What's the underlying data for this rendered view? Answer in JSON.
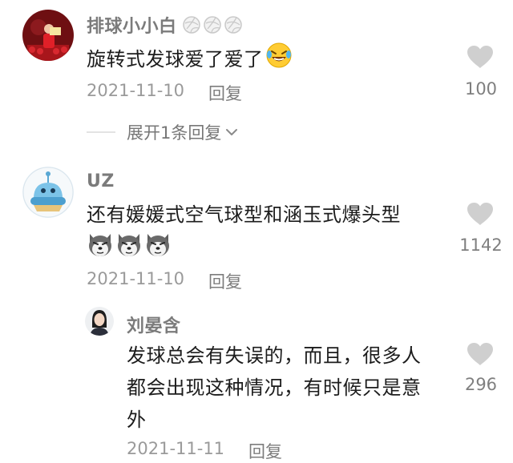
{
  "comments": [
    {
      "username": "排球小小白",
      "text": "旋转式发球爱了爱了",
      "date": "2021-11-10",
      "reply_label": "回复",
      "likes": "100",
      "expand_label": "展开1条回复"
    },
    {
      "username": "UZ",
      "text": "还有媛媛式空气球型和涵玉式爆头型",
      "date": "2021-11-10",
      "reply_label": "回复",
      "likes": "1142"
    }
  ],
  "reply": {
    "username": "刘晏含",
    "text_line1": "发球总会有失误的，而且，很多人",
    "text_line2": "都会出现这种情况，有时候只是意",
    "text_line3": "外",
    "date": "2021-11-11",
    "reply_label": "回复",
    "likes": "296"
  },
  "icons": {
    "like": "heart-icon",
    "expand": "chevron-down-icon",
    "volleyball": "volleyball-emoji",
    "laugh": "laughing-emoji",
    "dog": "dog-emoji"
  },
  "colors": {
    "username": "#7b7b7b",
    "text": "#1c1c1c",
    "meta": "#9a9a9a",
    "heart": "#cfcfcf"
  }
}
